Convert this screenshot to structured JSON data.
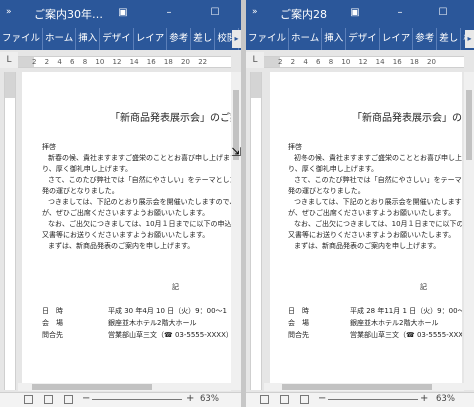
{
  "ribbon_tabs": [
    "ファイル",
    "ホーム",
    "挿入",
    "デザイ",
    "レイア",
    "参考",
    "差し",
    "校閲"
  ],
  "window1": {
    "title": "ご案内30年…",
    "zoom": "63%",
    "doc": {
      "title_text": "「新商品発表展示会」のご案",
      "greeting": "拝啓",
      "p1": "新春の候、貴社ますますご盛栄のこととお喜び申し上げます",
      "p1b": "り、厚く御礼申し上げます。",
      "p2": "さて、このたび弊社では「自然にやさしい」をテーマとした新",
      "p2b": "発の運びとなりました。",
      "p3": "つきましては、下記のとおり展示会を開催いたしますので、",
      "p3b": "が、ぜひご出席くださいますようお願いいたします。",
      "p4": "なお、ご出欠につきましては、10月１日までに以下の申込書",
      "p4b": "又書等にお送りくださいますようお願いいたします。",
      "p5": "まずは、新商品発表のご案内を申し上げます。",
      "ki": "記",
      "row1_label": "日　時",
      "row1_value": "平成 30 年4月 10 日（火）9：00〜1",
      "row2_label": "会　場",
      "row2_value": "銀座並木ホテル2階大ホール",
      "row3_label": "問合先",
      "row3_value": "営業部山草三文（☎ 03-5555-XXXX）"
    }
  },
  "window2": {
    "title": "ご案内28",
    "zoom": "63%",
    "doc": {
      "title_text": "「新商品発表展示会」のご案",
      "greeting": "拝啓",
      "p1": "初冬の候、貴社ますますご盛栄のこととお喜び申し上げま",
      "p1b": "り、厚く御礼申し上げます。",
      "p2": "さて、このたび弊社では「自然にやさしい」をテーマとした",
      "p2b": "発の運びとなりました。",
      "p3": "つきましては、下記のとおり展示会を開催いたしますので",
      "p3b": "が、ぜひご出席くださいますようお願いいたします。",
      "p4": "なお、ご出欠につきましては、10月１日までに以下の申込",
      "p4b": "又書等にお送りくださいますようお願いいたします。",
      "p5": "まずは、新商品発表のご案内を申し上げます。",
      "ki": "記",
      "row1_label": "日　時",
      "row1_value": "平成 28 年11月 1 日（火）9：00〜5",
      "row2_label": "会　場",
      "row2_value": "銀座並木ホテル2階大ホール",
      "row3_label": "問合先",
      "row3_value": "営業部山草三文（☎ 03-5555-XXXX）"
    }
  },
  "ruler": {
    "corner": "L",
    "w1_numbers": "2 2 4 6 8 10 12 14 16 18 20 22",
    "w2_numbers": "2 2 4 6 8 10 12 14 16 18 20"
  },
  "icons": {
    "qat": "double-chevron-icon",
    "restore": "restore-icon",
    "minimize": "minimize-icon",
    "maximize": "maximize-icon",
    "ribbon_more": "chevron-right-icon"
  },
  "colors": {
    "titlebar": "#2b579a",
    "page": "#ffffff"
  }
}
